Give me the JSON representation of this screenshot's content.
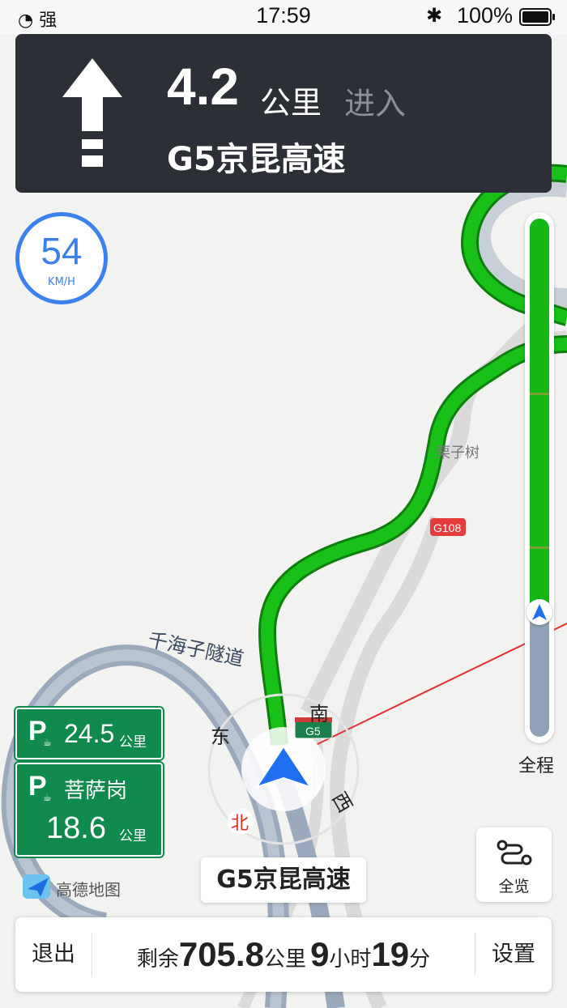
{
  "status_bar": {
    "signal_label": "强",
    "time": "17:59",
    "battery_percent": "100%"
  },
  "turn_panel": {
    "maneuver_icon": "straight-arrow-icon",
    "distance_value": "4.2",
    "distance_unit": "公里",
    "action": "进入",
    "road_name": "G5京昆高速"
  },
  "speed": {
    "value": "54",
    "unit": "KM/H"
  },
  "map_labels": {
    "tunnel": "千海子隧道",
    "village": "栗子树",
    "g108": "G108",
    "g5_shield": "G5",
    "compass_east": "东",
    "compass_south": "南",
    "compass_west": "西",
    "compass_north": "北"
  },
  "route_progress": {
    "traveled_fraction": 0.76,
    "label": "全程"
  },
  "service_areas": [
    {
      "distance": "24.5",
      "unit": "公里",
      "name": ""
    },
    {
      "distance": "18.6",
      "unit": "公里",
      "name": "菩萨岗"
    }
  ],
  "overview_button": {
    "label": "全览",
    "icon": "route-overview-icon"
  },
  "logo": {
    "text": "高德地图"
  },
  "current_road": "G5京昆高速",
  "bottom_bar": {
    "exit_label": "退出",
    "remaining_prefix": "剩余",
    "remaining_distance": "705.8",
    "distance_unit": "公里",
    "hours": "9",
    "hours_unit": "小时",
    "minutes": "19",
    "minutes_unit": "分",
    "settings_label": "设置"
  },
  "colors": {
    "route_green": "#16b816",
    "panel_dark": "#2c3036",
    "speed_blue": "#3b82f0",
    "sign_green": "#0f8a4c",
    "car_blue": "#1f6ff0"
  }
}
